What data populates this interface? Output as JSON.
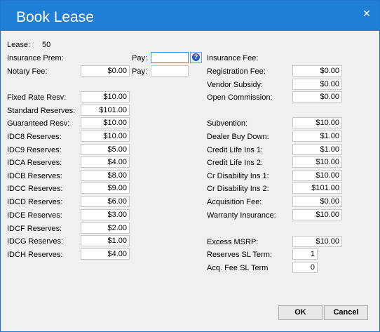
{
  "window": {
    "title": "Book Lease",
    "close_glyph": "✕"
  },
  "lease": {
    "label": "Lease:",
    "value": "50"
  },
  "insurance_prem": {
    "label": "Insurance Prem:"
  },
  "pay": {
    "label": "Pay:",
    "value": "",
    "help_glyph": "?"
  },
  "notary_fee": {
    "label": "Notary Fee:",
    "value": "$0.00"
  },
  "pay2": {
    "label": "Pay:",
    "value": ""
  },
  "left_fields": [
    {
      "label": "Fixed Rate Resv:",
      "value": "$10.00"
    },
    {
      "label": "Standard Reserves:",
      "value": "$101.00"
    },
    {
      "label": "Guaranteed Resv:",
      "value": "$10.00"
    },
    {
      "label": "IDC8 Reserves:",
      "value": "$10.00"
    },
    {
      "label": "IDC9 Reserves:",
      "value": "$5.00"
    },
    {
      "label": "IDCA Reserves:",
      "value": "$4.00"
    },
    {
      "label": "IDCB Reserves:",
      "value": "$8.00"
    },
    {
      "label": "IDCC Reserves:",
      "value": "$9.00"
    },
    {
      "label": "IDCD Reserves:",
      "value": "$6.00"
    },
    {
      "label": "IDCE Reserves:",
      "value": "$3.00"
    },
    {
      "label": "IDCF Reserves:",
      "value": "$2.00"
    },
    {
      "label": "IDCG Reserves:",
      "value": "$1.00"
    },
    {
      "label": "IDCH Reserves:",
      "value": "$4.00"
    }
  ],
  "insurance_fee": {
    "label": "Insurance Fee:"
  },
  "right_top": [
    {
      "label": "Registration Fee:",
      "value": "$0.00"
    },
    {
      "label": "Vendor Subsidy:",
      "value": "$0.00"
    },
    {
      "label": "Open Commission:",
      "value": "$0.00"
    }
  ],
  "right_mid": [
    {
      "label": "Subvention:",
      "value": "$10.00"
    },
    {
      "label": "Dealer Buy Down:",
      "value": "$1.00"
    },
    {
      "label": "Credit Life Ins 1:",
      "value": "$1.00"
    },
    {
      "label": "Credit Life Ins 2:",
      "value": "$10.00"
    },
    {
      "label": "Cr Disability Ins 1:",
      "value": "$10.00"
    },
    {
      "label": "Cr Disability Ins 2:",
      "value": "$101.00"
    },
    {
      "label": "Acquisition Fee:",
      "value": "$0.00"
    },
    {
      "label": "Warranty Insurance:",
      "value": "$10.00"
    }
  ],
  "excess_msrp": {
    "label": "Excess MSRP:",
    "value": "$10.00"
  },
  "reserves_sl_term": {
    "label": "Reserves SL Term:",
    "value": "1"
  },
  "acq_fee_sl_term": {
    "label": "Acq. Fee SL Term",
    "value": "0"
  },
  "buttons": {
    "ok": "OK",
    "cancel": "Cancel"
  }
}
